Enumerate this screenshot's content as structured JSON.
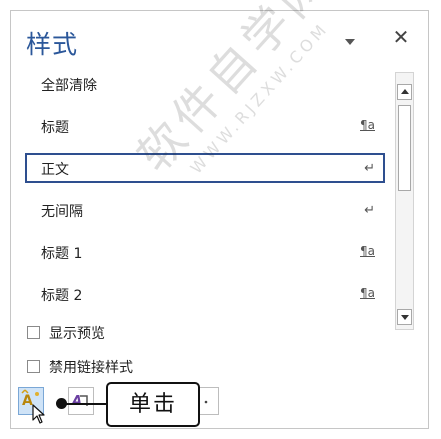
{
  "pane": {
    "title": "样式",
    "close_symbol": "✕"
  },
  "styles": [
    {
      "label": "全部清除",
      "marker": ""
    },
    {
      "label": "标题",
      "marker": "¶a"
    },
    {
      "label": "正文",
      "marker": "↵"
    },
    {
      "label": "无间隔",
      "marker": "↵"
    },
    {
      "label": "标题 1",
      "marker": "¶a"
    },
    {
      "label": "标题 2",
      "marker": "¶a"
    }
  ],
  "selected_style": "正文",
  "options": {
    "show_preview": {
      "label": "显示预览",
      "checked": false
    },
    "disable_linked_styles": {
      "label": "禁用链接样式",
      "checked": false
    }
  },
  "toolbar": {
    "buttons": [
      {
        "name": "new-style",
        "icon": "new-style-icon",
        "active": true
      },
      {
        "name": "style-inspector",
        "icon": "style-inspector-icon",
        "active": false
      },
      {
        "name": "manage-styles",
        "icon": "manage-styles-icon",
        "active": false
      }
    ]
  },
  "callout": {
    "text": "单击"
  },
  "watermark": {
    "main": "软件自学网",
    "sub": "WWW.RJZXW.COM"
  },
  "colors": {
    "title": "#2b579a",
    "selection_border": "#2e4f8f"
  }
}
